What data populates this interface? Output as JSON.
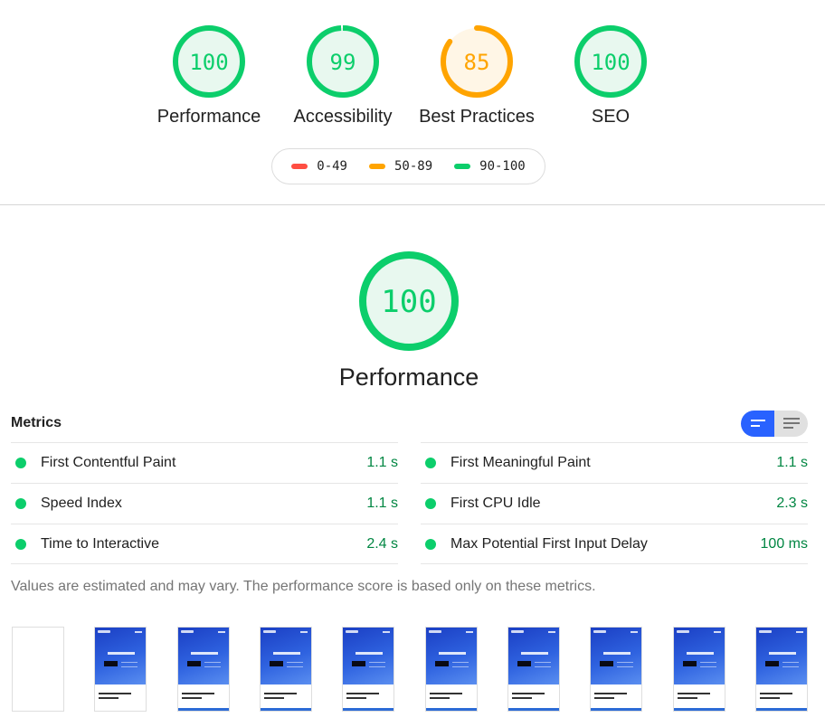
{
  "categories": [
    {
      "id": "performance",
      "label": "Performance",
      "score": "100",
      "score_value": 100,
      "rating": "pass"
    },
    {
      "id": "accessibility",
      "label": "Accessibility",
      "score": "99",
      "score_value": 99,
      "rating": "pass"
    },
    {
      "id": "best-practices",
      "label": "Best Practices",
      "score": "85",
      "score_value": 85,
      "rating": "average"
    },
    {
      "id": "seo",
      "label": "SEO",
      "score": "100",
      "score_value": 100,
      "rating": "pass"
    }
  ],
  "legend": [
    {
      "range": "0-49",
      "color": "#ff4e42"
    },
    {
      "range": "50-89",
      "color": "#ffa400"
    },
    {
      "range": "90-100",
      "color": "#0cce6b"
    }
  ],
  "colors": {
    "pass": "#0cce6b",
    "pass_text": "#0cce6b",
    "pass_bg": "#e8f8ef",
    "average": "#ffa400",
    "average_text": "#ffa400",
    "average_bg": "#fff6e6",
    "fail": "#ff4e42",
    "metric_value": "#018642",
    "toggle_active": "#2962ff"
  },
  "detail": {
    "score": "100",
    "score_value": 100,
    "label": "Performance"
  },
  "metrics": {
    "title": "Metrics",
    "toggle": {
      "active": "compact-view",
      "options": [
        "compact-view",
        "expanded-view"
      ]
    },
    "left": [
      {
        "name": "First Contentful Paint",
        "value": "1.1 s"
      },
      {
        "name": "Speed Index",
        "value": "1.1 s"
      },
      {
        "name": "Time to Interactive",
        "value": "2.4 s"
      }
    ],
    "right": [
      {
        "name": "First Meaningful Paint",
        "value": "1.1 s"
      },
      {
        "name": "First CPU Idle",
        "value": "2.3 s"
      },
      {
        "name": "Max Potential First Input Delay",
        "value": "100 ms"
      }
    ],
    "note": "Values are estimated and may vary. The performance score is based only on these metrics."
  },
  "filmstrip": {
    "frames": [
      {
        "state": "blank"
      },
      {
        "state": "loaded",
        "hero_heading": "Let's Work Together.",
        "bottom_bar": false
      },
      {
        "state": "loaded",
        "hero_heading": "Let's Work Together.",
        "bottom_bar": true
      },
      {
        "state": "loaded",
        "hero_heading": "Let's Work Together.",
        "bottom_bar": true
      },
      {
        "state": "loaded",
        "hero_heading": "Let's Work Together.",
        "bottom_bar": true
      },
      {
        "state": "loaded",
        "hero_heading": "Let's Work Together.",
        "bottom_bar": true
      },
      {
        "state": "loaded",
        "hero_heading": "Let's Work Together.",
        "bottom_bar": true
      },
      {
        "state": "loaded",
        "hero_heading": "Let's Work Together.",
        "bottom_bar": true
      },
      {
        "state": "loaded",
        "hero_heading": "Let's Work Together.",
        "bottom_bar": true
      },
      {
        "state": "loaded",
        "hero_heading": "Let's Work Together.",
        "bottom_bar": true
      }
    ]
  }
}
